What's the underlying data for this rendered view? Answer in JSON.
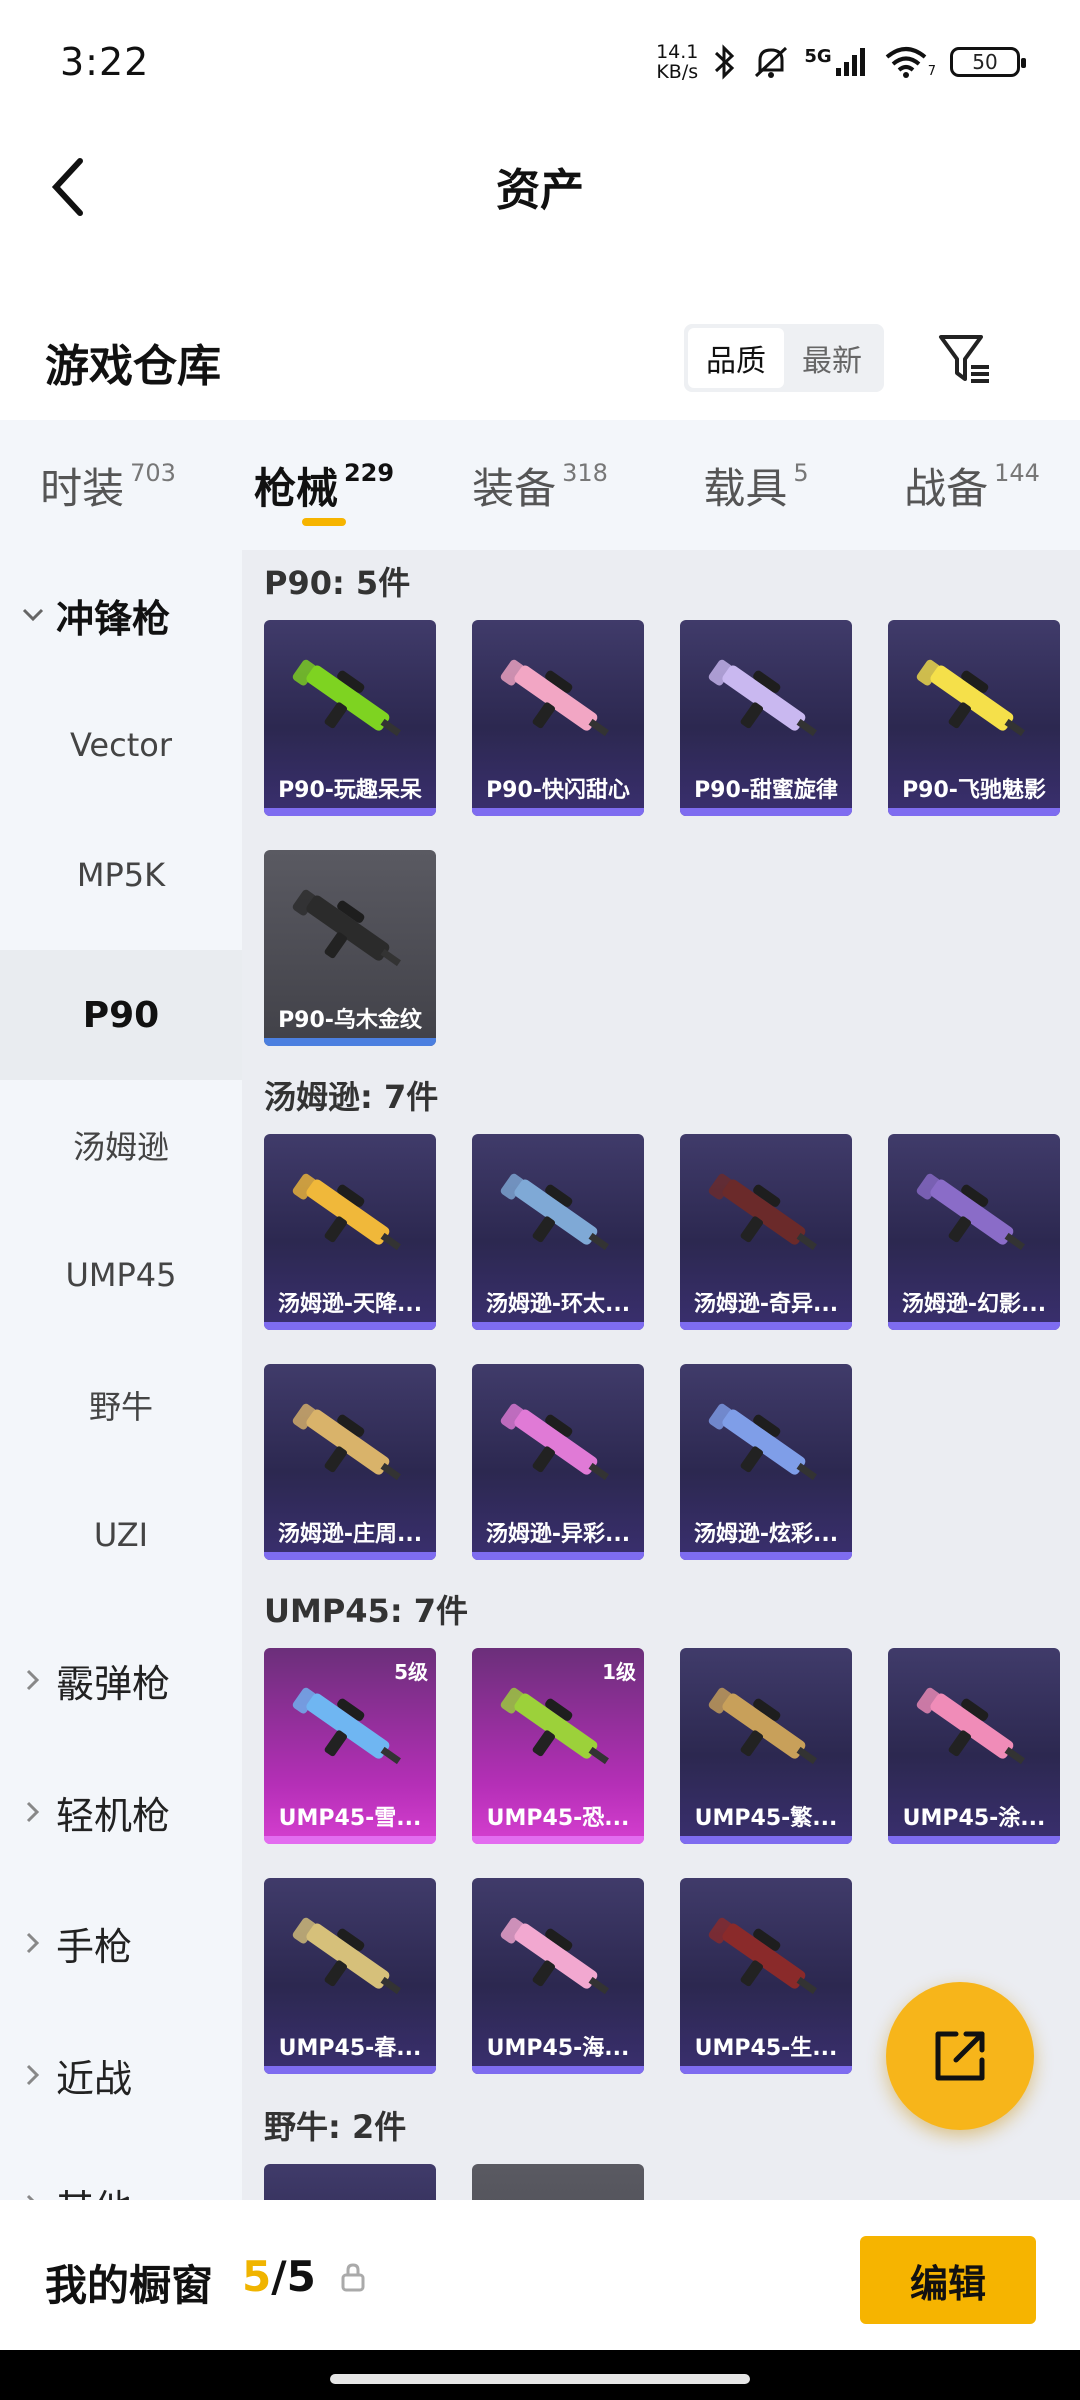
{
  "status": {
    "time": "3:22",
    "net_speed_value": "14.1",
    "net_speed_unit": "KB/s",
    "network": "5G",
    "wifi_badge": "7",
    "battery": "50"
  },
  "header": {
    "title": "资产"
  },
  "warehouse": {
    "title": "游戏仓库",
    "sort_options": [
      "品质",
      "最新"
    ],
    "sort_selected": "品质"
  },
  "tabs": [
    {
      "label": "时装",
      "count": "703"
    },
    {
      "label": "枪械",
      "count": "229"
    },
    {
      "label": "装备",
      "count": "318"
    },
    {
      "label": "载具",
      "count": "5"
    },
    {
      "label": "战备",
      "count": "144"
    }
  ],
  "sidebar": {
    "open_category": "冲锋枪",
    "sub_items": [
      "Vector",
      "MP5K",
      "P90",
      "汤姆逊",
      "UMP45",
      "野牛",
      "UZI"
    ],
    "active_item": "P90",
    "categories": [
      "霰弹枪",
      "轻机枪",
      "手枪",
      "近战",
      "其他"
    ]
  },
  "sections": [
    {
      "title": "P90: 5件",
      "items": [
        {
          "name": "P90-玩趣呆呆",
          "color": "#7ed321",
          "style": "purple"
        },
        {
          "name": "P90-快闪甜心",
          "color": "#f2a6c4",
          "style": "purple"
        },
        {
          "name": "P90-甜蜜旋律",
          "color": "#c9b8f0",
          "style": "purple"
        },
        {
          "name": "P90-飞驰魅影",
          "color": "#f5e04a",
          "style": "purple"
        },
        {
          "name": "P90-乌木金纹",
          "color": "#2b2b2b",
          "style": "grey"
        }
      ]
    },
    {
      "title": "汤姆逊: 7件",
      "items": [
        {
          "name": "汤姆逊-天降...",
          "color": "#f0b83a",
          "style": "purple"
        },
        {
          "name": "汤姆逊-环太...",
          "color": "#7fa9d6",
          "style": "purple"
        },
        {
          "name": "汤姆逊-奇异...",
          "color": "#6b2a2a",
          "style": "purple"
        },
        {
          "name": "汤姆逊-幻影...",
          "color": "#8a6cc8",
          "style": "purple"
        },
        {
          "name": "汤姆逊-庄周...",
          "color": "#d9b36a",
          "style": "purple"
        },
        {
          "name": "汤姆逊-异彩...",
          "color": "#e07ad6",
          "style": "purple"
        },
        {
          "name": "汤姆逊-炫彩...",
          "color": "#7f9ee8",
          "style": "purple"
        }
      ]
    },
    {
      "title": "UMP45: 7件",
      "items": [
        {
          "name": "UMP45-雪...",
          "color": "#6fb6f2",
          "style": "pink",
          "level": "5级"
        },
        {
          "name": "UMP45-恐...",
          "color": "#9cd13a",
          "style": "pink",
          "level": "1级"
        },
        {
          "name": "UMP45-繁...",
          "color": "#c8a05a",
          "style": "purple"
        },
        {
          "name": "UMP45-涂...",
          "color": "#f08cb8",
          "style": "purple"
        },
        {
          "name": "UMP45-春...",
          "color": "#d6c07a",
          "style": "purple"
        },
        {
          "name": "UMP45-海...",
          "color": "#f2a8d0",
          "style": "purple"
        },
        {
          "name": "UMP45-生...",
          "color": "#8a2a2a",
          "style": "purple"
        }
      ]
    },
    {
      "title": "野牛: 2件",
      "items": [
        {
          "name": "",
          "color": "#c8a05a",
          "style": "purple"
        },
        {
          "name": "",
          "color": "#777777",
          "style": "grey"
        }
      ]
    }
  ],
  "bottom": {
    "label": "我的橱窗",
    "count_current": "5",
    "count_sep": "/",
    "count_total": "5",
    "edit_label": "编辑"
  },
  "colors": {
    "accent": "#f6b400",
    "card_strip": "#7e6cf0"
  }
}
